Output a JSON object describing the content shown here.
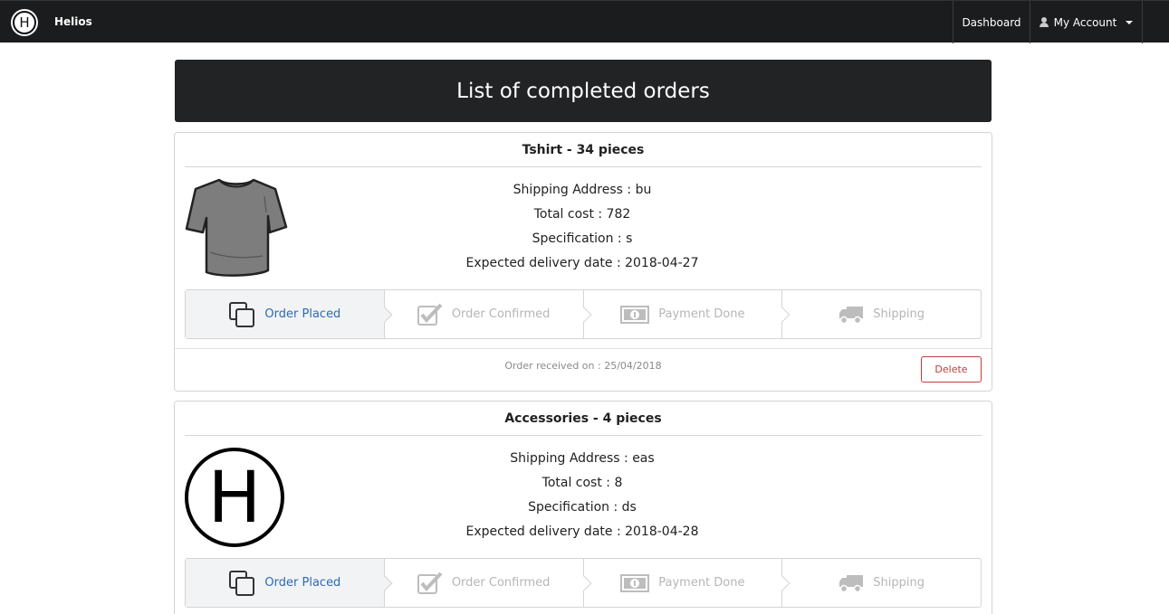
{
  "navbar": {
    "brand": "Helios",
    "logo_letter": "H",
    "dashboard_label": "Dashboard",
    "account_label": "My Account"
  },
  "page": {
    "title": "List of completed orders"
  },
  "orders": [
    {
      "title": "Tshirt - 34 pieces",
      "image": "tshirt-image",
      "shipping_address": "Shipping Address : bu",
      "total_cost": "Total cost : 782",
      "specification": "Specification : s",
      "expected_delivery": "Expected delivery date : 2018-04-27",
      "steps": [
        {
          "label": "Order Placed",
          "icon": "copy-icon",
          "active": true
        },
        {
          "label": "Order Confirmed",
          "icon": "checkbox-icon",
          "active": false
        },
        {
          "label": "Payment Done",
          "icon": "money-icon",
          "active": false
        },
        {
          "label": "Shipping",
          "icon": "truck-icon",
          "active": false
        }
      ],
      "received": "Order received on : 25/04/2018",
      "delete_label": "Delete"
    },
    {
      "title": "Accessories - 4 pieces",
      "image": "helios-logo-image",
      "image_letter": "H",
      "shipping_address": "Shipping Address : eas",
      "total_cost": "Total cost : 8",
      "specification": "Specification : ds",
      "expected_delivery": "Expected delivery date : 2018-04-28",
      "steps": [
        {
          "label": "Order Placed",
          "icon": "copy-icon",
          "active": true
        },
        {
          "label": "Order Confirmed",
          "icon": "checkbox-icon",
          "active": false
        },
        {
          "label": "Payment Done",
          "icon": "money-icon",
          "active": false
        },
        {
          "label": "Shipping",
          "icon": "truck-icon",
          "active": false
        }
      ]
    }
  ],
  "colors": {
    "navbar_bg": "#1b1c1d",
    "banner_bg": "#222325",
    "active_step": "#2c6bb5",
    "inactive_step": "#b6b6b6",
    "delete": "#c43b3b"
  }
}
